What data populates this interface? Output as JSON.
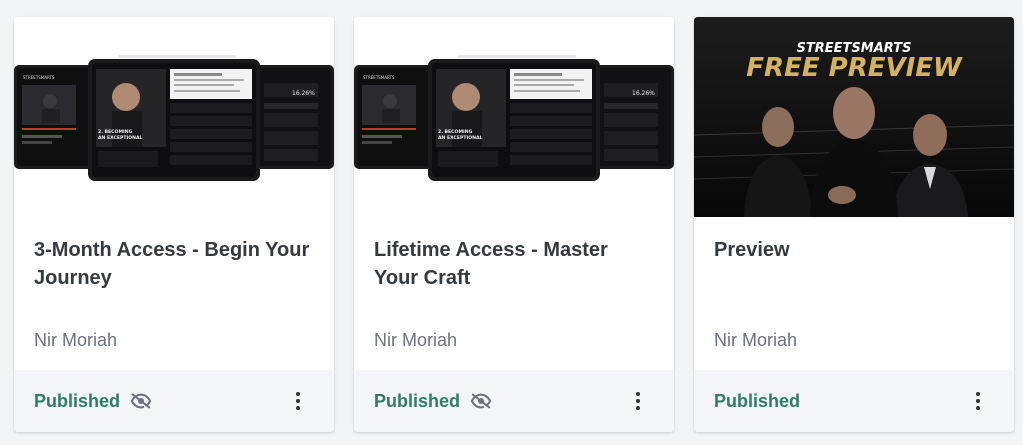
{
  "products": [
    {
      "title": "3-Month Access - Begin Your Journey",
      "author": "Nir Moriah",
      "status": "Published",
      "hidden_icon": "eye-off-icon",
      "menu_icon": "more-vert-icon",
      "thumbnail": {
        "brand": "STREETSMARTS",
        "heading": "2. BECOMING AN EXCEPTIONAL PERFORMER",
        "percent": "16.26%"
      }
    },
    {
      "title": "Lifetime Access - Master Your Craft",
      "author": "Nir Moriah",
      "status": "Published",
      "hidden_icon": "eye-off-icon",
      "menu_icon": "more-vert-icon",
      "thumbnail": {
        "brand": "STREETSMARTS",
        "heading": "2. BECOMING AN EXCEPTIONAL PERFORMER",
        "percent": "16.26%"
      }
    },
    {
      "title": "Preview",
      "author": "Nir Moriah",
      "status": "Published",
      "menu_icon": "more-vert-icon",
      "thumbnail": {
        "brand": "STREETSMARTS",
        "headline": "FREE PREVIEW"
      }
    }
  ],
  "colors": {
    "published": "#2e7d68",
    "headline_gold": "#d4b260",
    "card_bg": "#ffffff",
    "footer_bg": "#f4f5f8"
  }
}
